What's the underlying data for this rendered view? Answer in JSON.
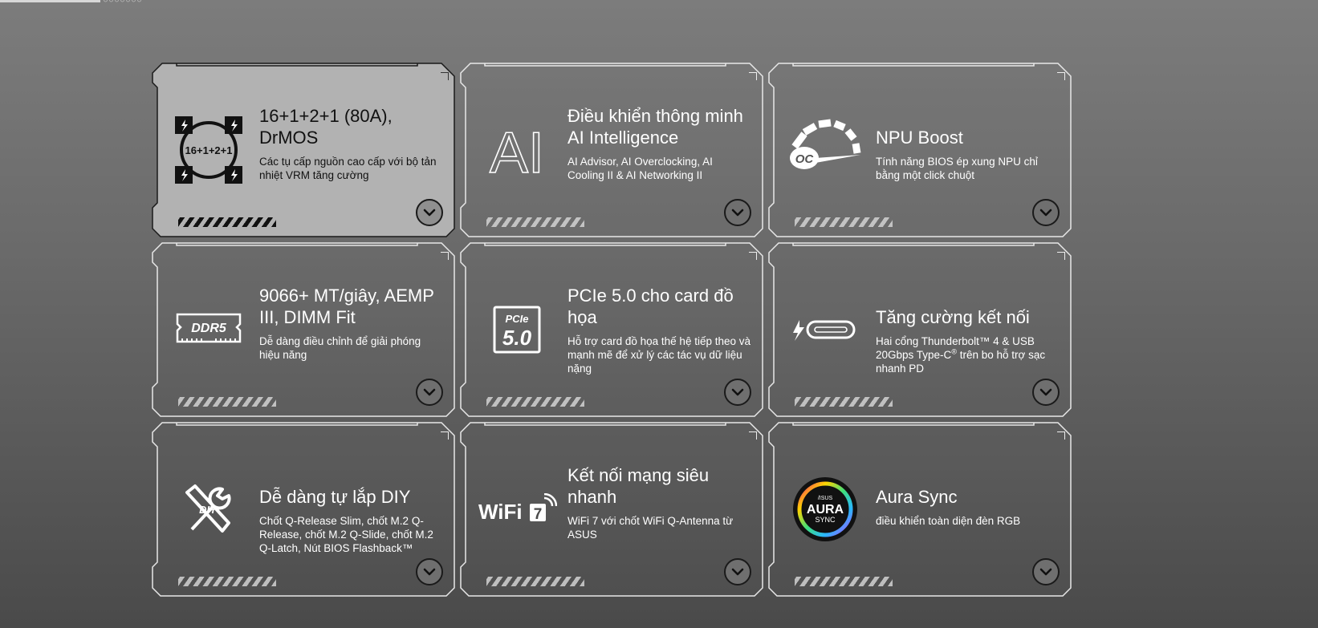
{
  "cards": [
    {
      "title": "16+1+2+1 (80A), DrMOS",
      "desc": "Các tụ cấp nguồn cao cấp với bộ tản nhiệt VRM tăng cường",
      "icon": "power-stage-icon",
      "icon_text": "16+1+2+1",
      "active": true
    },
    {
      "title": "Điều khiển thông minh AI Intelligence",
      "desc": "AI Advisor, AI Overclocking, AI Cooling II & AI Networking II",
      "icon": "ai-icon",
      "icon_text": "AI"
    },
    {
      "title": "NPU Boost",
      "desc": "Tính năng BIOS ép xung NPU chỉ bằng một click chuột",
      "icon": "oc-gauge-icon",
      "icon_text": "OC"
    },
    {
      "title": "9066+ MT/giây, AEMP III, DIMM Fit",
      "desc": "Dễ dàng điều chỉnh để giải phóng hiệu năng",
      "icon": "ddr5-memory-icon",
      "icon_text": "DDR5"
    },
    {
      "title": "PCIe 5.0 cho card đồ họa",
      "desc": "Hỗ trợ card đồ họa thế hệ tiếp theo và mạnh mẽ để xử lý các tác vụ dữ liệu nặng",
      "icon": "pcie-icon",
      "icon_text": "PCIe",
      "icon_text2": "5.0"
    },
    {
      "title": "Tăng cường kết nối",
      "desc_pre": "Hai cổng Thunderbolt™ 4 & USB 20Gbps Type-C",
      "desc_sup": "®",
      "desc_post": " trên bo hỗ trợ sạc nhanh PD",
      "icon": "thunderbolt-icon"
    },
    {
      "title": "Dễ dàng tự lắp DIY",
      "desc": "Chốt Q-Release Slim, chốt M.2 Q-Release, chốt M.2 Q-Slide, chốt M.2 Q-Latch, Nút BIOS Flashback™",
      "icon": "diy-tools-icon",
      "icon_text": "DIY"
    },
    {
      "title": "Kết nối mạng siêu nhanh",
      "desc": "WiFi 7 với chốt WiFi Q-Antenna từ ASUS",
      "icon": "wifi7-icon",
      "icon_text": "WiFi",
      "icon_text2": "7"
    },
    {
      "title": "Aura Sync",
      "desc": "điều khiển toàn diện đèn RGB",
      "icon": "aura-sync-icon",
      "icon_text": "/ISUS",
      "icon_text2": "AURA",
      "icon_text3": "SYNC"
    }
  ]
}
